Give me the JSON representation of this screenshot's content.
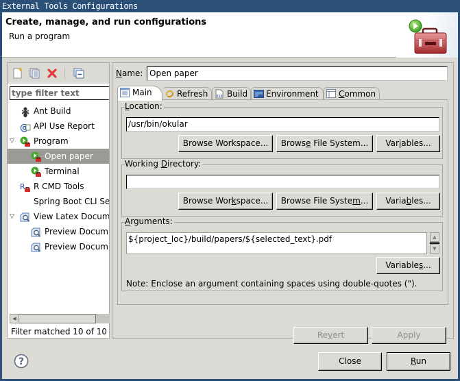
{
  "window": {
    "title": "External Tools Configurations"
  },
  "header": {
    "title": "Create, manage, and run configurations",
    "subtitle": "Run a program",
    "icon": "toolbox-run-icon"
  },
  "left_panel": {
    "toolbar": [
      {
        "name": "new-configuration",
        "icon": "new-file-icon"
      },
      {
        "name": "duplicate",
        "icon": "duplicate-icon"
      },
      {
        "name": "delete",
        "icon": "delete-x-icon"
      },
      {
        "name": "collapse-all",
        "icon": "collapse-all-icon"
      }
    ],
    "filter_placeholder": "type filter text",
    "tree": [
      {
        "label": "Ant Build",
        "icon": "ant-icon",
        "level": 0,
        "expander": ""
      },
      {
        "label": "API Use Report",
        "icon": "api-report-icon",
        "level": 0,
        "expander": ""
      },
      {
        "label": "Program",
        "icon": "program-run-icon",
        "level": 0,
        "expander": "expanded"
      },
      {
        "label": "Open paper",
        "icon": "program-run-icon",
        "level": 1,
        "expander": "",
        "selected": true
      },
      {
        "label": "Terminal",
        "icon": "program-run-icon",
        "level": 1,
        "expander": ""
      },
      {
        "label": "R CMD Tools",
        "icon": "r-tools-icon",
        "level": 0,
        "expander": ""
      },
      {
        "label": "Spring Boot CLI Se",
        "icon": "",
        "level": 0,
        "expander": ""
      },
      {
        "label": "View Latex Docum",
        "icon": "document-preview-icon",
        "level": 0,
        "expander": "expanded"
      },
      {
        "label": "Preview Docum",
        "icon": "document-preview-icon",
        "level": 1,
        "expander": ""
      },
      {
        "label": "Preview Docum",
        "icon": "document-preview-icon",
        "level": 1,
        "expander": ""
      }
    ],
    "filter_status": "Filter matched 10 of 10"
  },
  "right_panel": {
    "name_label": "Name:",
    "name_value": "Open paper",
    "tabs": [
      {
        "label": "Main",
        "icon": "main-tab-icon",
        "active": true
      },
      {
        "label": "Refresh",
        "icon": "refresh-icon",
        "active": false
      },
      {
        "label": "Build",
        "icon": "build-binary-icon",
        "active": false
      },
      {
        "label": "Environment",
        "icon": "environment-icon",
        "active": false
      },
      {
        "label": "Common",
        "icon": "common-table-icon",
        "active": false
      }
    ],
    "location": {
      "label": "Location:",
      "value": "/usr/bin/okular",
      "buttons": [
        "Browse Workspace...",
        "Browse File System...",
        "Variables..."
      ]
    },
    "working_directory": {
      "label": "Working Directory:",
      "value": "",
      "buttons": [
        "Browse Workspace...",
        "Browse File System...",
        "Variables..."
      ]
    },
    "arguments": {
      "label": "Arguments:",
      "value": "${project_loc}/build/papers/${selected_text}.pdf",
      "variables_button": "Variables...",
      "note": "Note: Enclose an argument containing spaces using double-quotes (\")."
    },
    "revert_button": "Revert",
    "apply_button": "Apply"
  },
  "footer": {
    "help_icon": "help-icon",
    "close_button": "Close",
    "run_button": "Run"
  }
}
